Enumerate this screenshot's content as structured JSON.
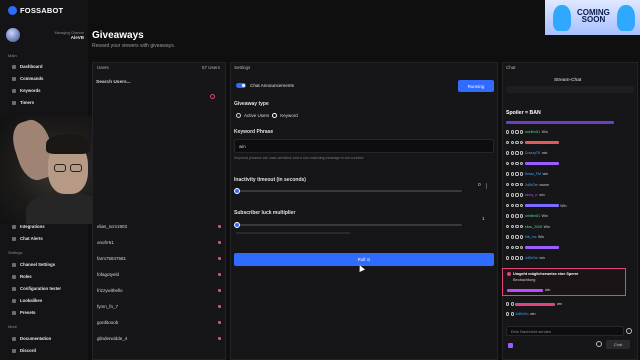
{
  "app": {
    "brand": "FOSSABOT"
  },
  "profile": {
    "subtitle": "Managing Channel",
    "name": "AleVB"
  },
  "nav": {
    "main_label": "Main",
    "items_top": [
      "Dashboard",
      "Commands",
      "Keywords",
      "Timers"
    ],
    "items_mid": [
      "Integrations",
      "Chat Alerts"
    ],
    "settings_label": "Settings",
    "settings_items": [
      "Channel Settings",
      "Roles",
      "Configuration tester",
      "Lookalikes",
      "Presets"
    ],
    "more_label": "More",
    "more_items": [
      "Documentation",
      "Discord"
    ]
  },
  "page": {
    "title": "Giveaways",
    "subtitle": "Reward your viewers with giveaways."
  },
  "users": {
    "header": "Users",
    "count": "57 Users",
    "search_label": "Search Users...",
    "list": [
      "elias_scm1903",
      "onofrr61",
      "farm75847681",
      "fofagotyeld",
      "frizzywithello",
      "fymn_fn_7",
      "gorditooob",
      "glinderwidde_4"
    ]
  },
  "settings": {
    "header": "Settings",
    "announce_label": "Chat Announcements",
    "running_btn": "Running",
    "giveaway_type_label": "Giveaway type",
    "type_options": [
      "Active Users",
      "Keyword"
    ],
    "keyword_label": "Keyword Phrase",
    "keyword_value": "win",
    "keyword_hint": "Keyword phrases are case-sensitive and a non-matching message is not counted",
    "inactivity_label": "Inactivity timeout (in seconds)",
    "inactivity_value": "0",
    "inactivity_fraction": 0.0,
    "sub_label": "Subscriber luck multiplier",
    "sub_value": "1",
    "sub_fraction": 0.0,
    "roll_btn": "Roll ⊙"
  },
  "chat": {
    "header": "Chat",
    "title": "Stream-Chat",
    "spoiler": "Spoiler = BAN",
    "lines": [
      {
        "name": "ariellim81",
        "msg": "Win",
        "color": "#3ddc84"
      },
      {
        "name": "",
        "msg": "",
        "color": "#e05a5a"
      },
      {
        "name": "CrazzyTK",
        "msg": "win",
        "color": "#3fa9ff"
      },
      {
        "name": "",
        "msg": "",
        "color": "#9a5cff"
      },
      {
        "name": "Smaz_FM",
        "msg": "win",
        "color": "#3fa9ff"
      },
      {
        "name": "JoBrOm",
        "msg": "wonm",
        "color": "#3fa9ff"
      },
      {
        "name": "aiony_rr",
        "msg": "win",
        "color": "#b84cff"
      },
      {
        "name": "",
        "msg": "Win",
        "color": "#7b6cff"
      },
      {
        "name": "ariellim81",
        "msg": "Win",
        "color": "#3ddc84"
      },
      {
        "name": "elias_2008",
        "msg": "Win",
        "color": "#3ddc84"
      },
      {
        "name": "frib_mc",
        "msg": "Win",
        "color": "#3fa9ff"
      },
      {
        "name": "",
        "msg": "",
        "color": "#9a5cff"
      },
      {
        "name": "JoBrOm",
        "msg": "win",
        "color": "#3fa9ff"
      }
    ],
    "pinned_title": "Umgeht möglicherweise eine Sperre",
    "pinned_sub": "Beobachtung",
    "pinned_msg": "win",
    "after_lines": [
      {
        "name": "",
        "msg": "win",
        "color": "#e0447a"
      },
      {
        "name": "JoBrOm",
        "msg": "win",
        "color": "#3fa9ff"
      }
    ],
    "send_placeholder": "Eine Nachricht senden",
    "chat_btn": "Chat"
  },
  "promo": {
    "line1": "COMING",
    "line2": "SOON"
  },
  "colors": {
    "accent": "#2f6bff",
    "danger": "#d64f7a",
    "panel": "#161618"
  }
}
